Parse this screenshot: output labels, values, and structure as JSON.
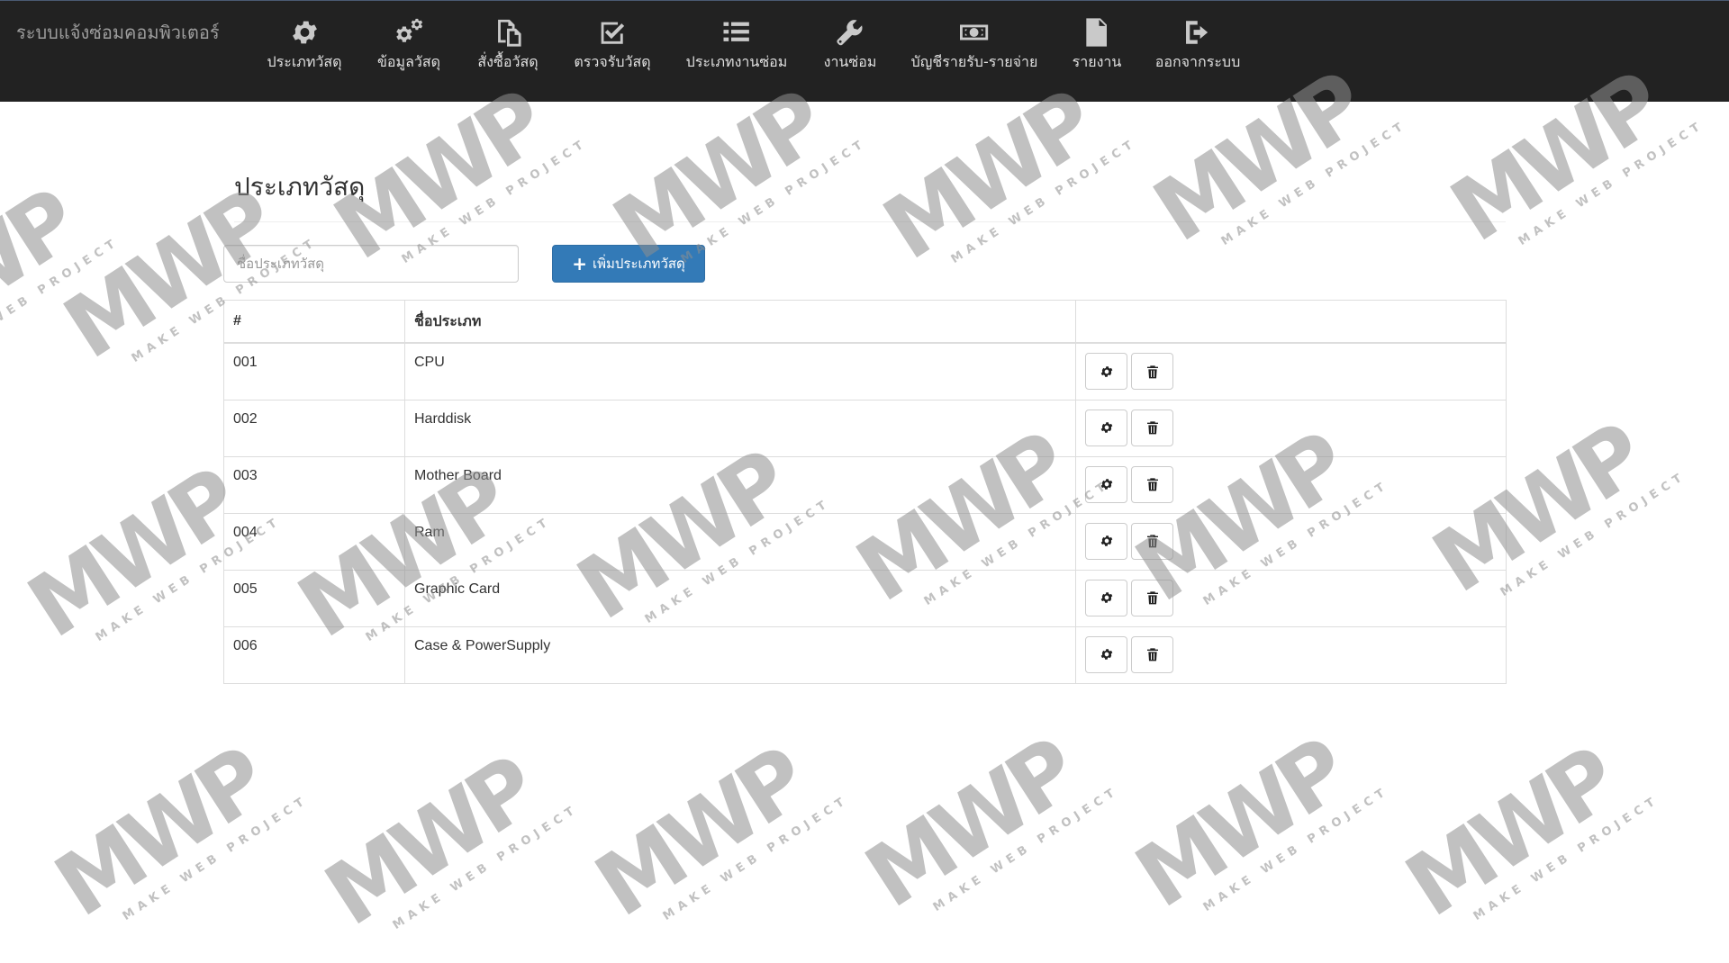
{
  "app": {
    "brand": "ระบบแจ้งซ่อมคอมพิวเตอร์"
  },
  "nav": {
    "items": [
      {
        "label": "ประเภทวัสดุ",
        "icon": "gear-icon"
      },
      {
        "label": "ข้อมูลวัสดุ",
        "icon": "gears-icon"
      },
      {
        "label": "สั่งซื้อวัสดุ",
        "icon": "copy-icon"
      },
      {
        "label": "ตรวจรับวัสดุ",
        "icon": "check-square-icon"
      },
      {
        "label": "ประเภทงานซ่อม",
        "icon": "list-icon"
      },
      {
        "label": "งานซ่อม",
        "icon": "wrench-icon"
      },
      {
        "label": "บัญชีรายรับ-รายจ่าย",
        "icon": "money-icon"
      },
      {
        "label": "รายงาน",
        "icon": "document-icon"
      },
      {
        "label": "ออกจากระบบ",
        "icon": "logout-icon"
      }
    ]
  },
  "page": {
    "title": "ประเภทวัสดุ"
  },
  "form": {
    "name_placeholder": "ชื่อประเภทวัสดุ",
    "name_value": "",
    "add_label": "เพิ่มประเภทวัสดุ"
  },
  "table": {
    "headers": [
      "#",
      "ชื่อประเภท",
      ""
    ],
    "rows": [
      {
        "id": "001",
        "name": "CPU"
      },
      {
        "id": "002",
        "name": "Harddisk"
      },
      {
        "id": "003",
        "name": "Mother Board"
      },
      {
        "id": "004",
        "name": "Ram"
      },
      {
        "id": "005",
        "name": "Graphic Card"
      },
      {
        "id": "006",
        "name": "Case & PowerSupply"
      }
    ],
    "row_actions": [
      "gear-icon",
      "trash-icon"
    ]
  },
  "watermark": {
    "logo": "MWP",
    "subtitle": "MAKE WEB PROJECT"
  },
  "colors": {
    "navbar_bg": "#222222",
    "primary": "#337ab7",
    "nav_text": "#e0e0e0",
    "brand_text": "#9d9d9d"
  }
}
